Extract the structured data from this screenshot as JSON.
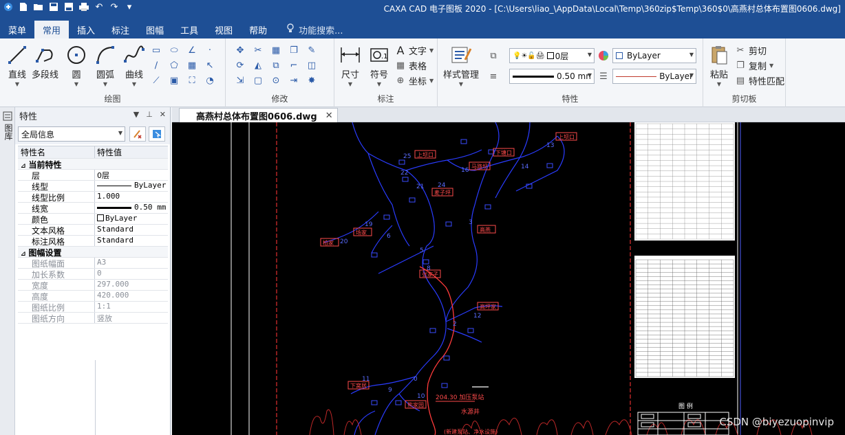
{
  "window": {
    "title": "CAXA CAD 电子图板 2020 - [C:\\Users\\liao_\\AppData\\Local\\Temp\\360zip$Temp\\360$0\\高燕村总体布置图0606.dwg]",
    "quick_access": [
      "menu-icon",
      "new-icon",
      "open-icon",
      "save-icon",
      "save-as-icon",
      "print-icon",
      "undo-icon",
      "redo-icon",
      "customize-icon"
    ]
  },
  "menu": {
    "items": [
      "菜单",
      "常用",
      "插入",
      "标注",
      "图幅",
      "工具",
      "视图",
      "帮助"
    ],
    "active": "常用",
    "search_placeholder": "功能搜索..."
  },
  "ribbon": {
    "draw": {
      "label": "绘图",
      "line": "直线",
      "polyline": "多段线",
      "circle": "圆",
      "arc": "圆弧",
      "curve": "曲线"
    },
    "modify": {
      "label": "修改"
    },
    "annotate": {
      "label": "标注",
      "dimension": "尺寸",
      "symbol": "符号",
      "text": "文字",
      "table": "表格",
      "coordinate": "坐标"
    },
    "properties": {
      "label": "特性",
      "style_manage": "样式管理",
      "layer": "0层",
      "color": "ByLayer",
      "lineweight": "0.50 mn",
      "linetype": "ByLayer"
    },
    "clipboard": {
      "label": "剪切板",
      "paste": "粘贴",
      "cut": "剪切",
      "copy": "复制",
      "match": "特性匹配"
    }
  },
  "doc_tab": {
    "name": "高燕村总体布置图0606.dwg"
  },
  "left_strip": {
    "label": "图库"
  },
  "properties_panel": {
    "title": "特性",
    "selector": "全局信息",
    "col_name": "特性名",
    "col_value": "特性值",
    "section_current": "当前特性",
    "rows_current": [
      {
        "k": "层",
        "v": "0层"
      },
      {
        "k": "线型",
        "v": "ByLayer"
      },
      {
        "k": "线型比例",
        "v": "1.000"
      },
      {
        "k": "线宽",
        "v": "0.50 mm"
      },
      {
        "k": "颜色",
        "v": "ByLayer"
      },
      {
        "k": "文本风格",
        "v": "Standard"
      },
      {
        "k": "标注风格",
        "v": "Standard"
      }
    ],
    "section_sheet": "图幅设置",
    "rows_sheet": [
      {
        "k": "图纸幅面",
        "v": "A3"
      },
      {
        "k": "加长系数",
        "v": "0"
      },
      {
        "k": "宽度",
        "v": "297.000"
      },
      {
        "k": "高度",
        "v": "420.000"
      },
      {
        "k": "图纸比例",
        "v": "1:1"
      },
      {
        "k": "图纸方向",
        "v": "竖放"
      }
    ]
  },
  "drawing": {
    "villages": [
      "上坝口",
      "下塘口",
      "上坝口",
      "马路坝",
      "麦子坪",
      "柏家",
      "场家",
      "高燕",
      "张家子",
      "高坪家",
      "下窝居",
      "熊家园"
    ],
    "node_numbers": [
      "13",
      "14",
      "16",
      "25",
      "22",
      "21",
      "24",
      "19",
      "20",
      "6",
      "5",
      "8",
      "12",
      "2",
      "11",
      "9",
      "10",
      "0",
      "3"
    ],
    "annotation": "204.30 加压泵站",
    "annotation2": "水源井",
    "annotation3": "(新建泵站、净水设施)",
    "legend_title": "图 例",
    "watermark": "CSDN @biyezuopinvip"
  }
}
